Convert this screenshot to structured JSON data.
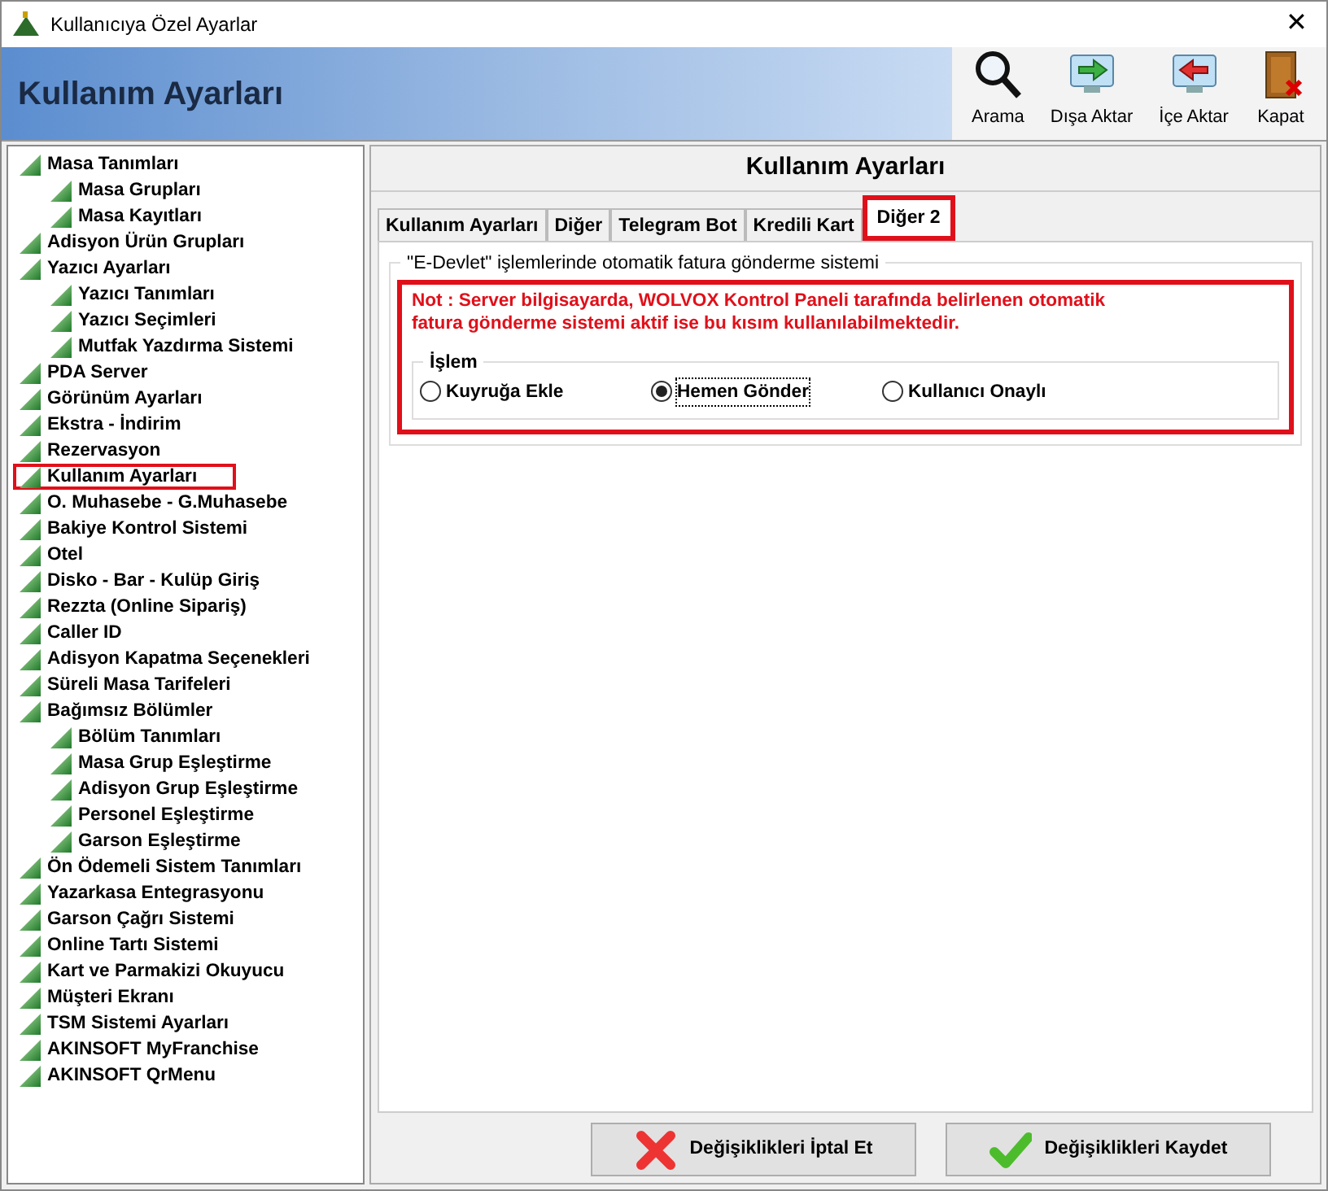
{
  "window": {
    "title": "Kullanıcıya Özel Ayarlar",
    "close": "✕"
  },
  "header": {
    "title": "Kullanım Ayarları",
    "tools": [
      {
        "label": "Arama",
        "kind": "search"
      },
      {
        "label": "Dışa Aktar",
        "kind": "export"
      },
      {
        "label": "İçe Aktar",
        "kind": "import"
      },
      {
        "label": "Kapat",
        "kind": "exit"
      }
    ]
  },
  "tree": [
    {
      "label": "Masa Tanımları",
      "highlighted": false,
      "children": [
        {
          "label": "Masa Grupları",
          "highlighted": false
        },
        {
          "label": "Masa Kayıtları",
          "highlighted": false
        }
      ]
    },
    {
      "label": "Adisyon Ürün Grupları",
      "highlighted": false
    },
    {
      "label": "Yazıcı Ayarları",
      "highlighted": false,
      "children": [
        {
          "label": "Yazıcı Tanımları",
          "highlighted": false
        },
        {
          "label": "Yazıcı Seçimleri",
          "highlighted": false
        },
        {
          "label": "Mutfak Yazdırma Sistemi",
          "highlighted": false
        }
      ]
    },
    {
      "label": "PDA Server",
      "highlighted": false
    },
    {
      "label": "Görünüm Ayarları",
      "highlighted": false
    },
    {
      "label": "Ekstra - İndirim",
      "highlighted": false
    },
    {
      "label": "Rezervasyon",
      "highlighted": false
    },
    {
      "label": "Kullanım Ayarları",
      "highlighted": true
    },
    {
      "label": "O. Muhasebe - G.Muhasebe",
      "highlighted": false
    },
    {
      "label": "Bakiye Kontrol Sistemi",
      "highlighted": false
    },
    {
      "label": "Otel",
      "highlighted": false
    },
    {
      "label": "Disko - Bar - Kulüp Giriş",
      "highlighted": false
    },
    {
      "label": "Rezzta (Online Sipariş)",
      "highlighted": false
    },
    {
      "label": "Caller ID",
      "highlighted": false
    },
    {
      "label": "Adisyon Kapatma Seçenekleri",
      "highlighted": false
    },
    {
      "label": "Süreli Masa Tarifeleri",
      "highlighted": false
    },
    {
      "label": "Bağımsız Bölümler",
      "highlighted": false,
      "children": [
        {
          "label": "Bölüm Tanımları",
          "highlighted": false
        },
        {
          "label": "Masa Grup Eşleştirme",
          "highlighted": false
        },
        {
          "label": "Adisyon Grup Eşleştirme",
          "highlighted": false
        },
        {
          "label": "Personel Eşleştirme",
          "highlighted": false
        },
        {
          "label": "Garson Eşleştirme",
          "highlighted": false
        }
      ]
    },
    {
      "label": "Ön Ödemeli Sistem Tanımları",
      "highlighted": false
    },
    {
      "label": "Yazarkasa Entegrasyonu",
      "highlighted": false
    },
    {
      "label": "Garson Çağrı Sistemi",
      "highlighted": false
    },
    {
      "label": "Online Tartı Sistemi",
      "highlighted": false
    },
    {
      "label": "Kart ve Parmakizi Okuyucu",
      "highlighted": false
    },
    {
      "label": "Müşteri Ekranı",
      "highlighted": false
    },
    {
      "label": "TSM Sistemi Ayarları",
      "highlighted": false
    },
    {
      "label": "AKINSOFT MyFranchise",
      "highlighted": false
    },
    {
      "label": "AKINSOFT QrMenu",
      "highlighted": false
    }
  ],
  "panel": {
    "title": "Kullanım Ayarları",
    "tabs": [
      {
        "label": "Kullanım Ayarları",
        "selected": false,
        "highlighted": false
      },
      {
        "label": "Diğer",
        "selected": false,
        "highlighted": false
      },
      {
        "label": "Telegram Bot",
        "selected": false,
        "highlighted": false
      },
      {
        "label": "Kredili Kart",
        "selected": false,
        "highlighted": false
      },
      {
        "label": "Diğer 2",
        "selected": true,
        "highlighted": true
      }
    ],
    "group": {
      "title": "\"E-Devlet\" işlemlerinde otomatik fatura gönderme sistemi",
      "highlighted": true,
      "note": "Not : Server bilgisayarda, WOLVOX Kontrol Paneli tarafında belirlenen otomatik fatura gönderme sistemi aktif ise bu kısım kullanılabilmektedir.",
      "subgroup": {
        "title": "İşlem",
        "options": [
          {
            "label": "Kuyruğa Ekle",
            "selected": false
          },
          {
            "label": "Hemen Gönder",
            "selected": true
          },
          {
            "label": "Kullanıcı Onaylı",
            "selected": false
          }
        ]
      }
    }
  },
  "buttons": [
    {
      "label": "Değişiklikleri İptal Et",
      "kind": "cancel"
    },
    {
      "label": "Değişiklikleri Kaydet",
      "kind": "save"
    }
  ]
}
